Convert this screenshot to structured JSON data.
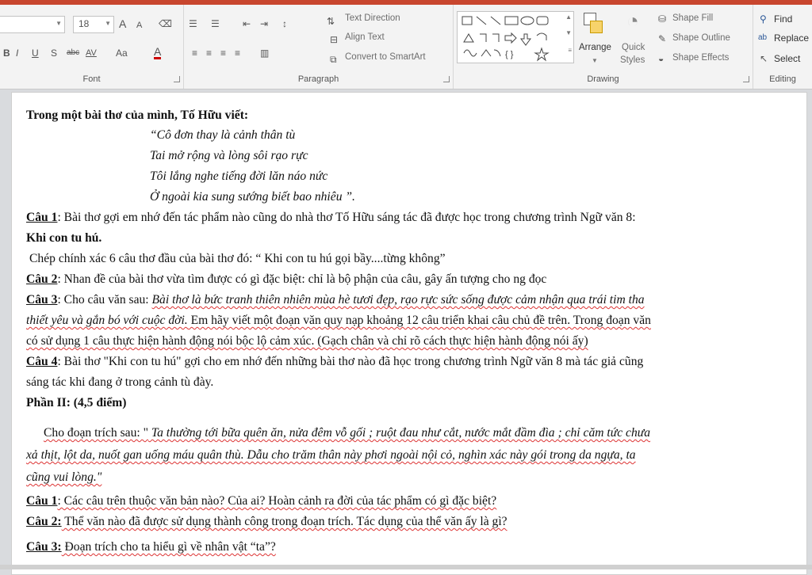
{
  "ribbon": {
    "font": {
      "label": "Font",
      "size_value": "18",
      "grow": "A",
      "shrink": "A",
      "bold": "B",
      "italic": "I",
      "underline": "U",
      "shadow": "S",
      "strike": "abc",
      "spacing": "AV",
      "case": "Aa",
      "color": "A"
    },
    "paragraph": {
      "label": "Paragraph",
      "text_direction": "Text Direction",
      "align_text": "Align Text",
      "convert_smartart": "Convert to SmartArt"
    },
    "drawing": {
      "label": "Drawing",
      "arrange": "Arrange",
      "quick_styles_1": "Quick",
      "quick_styles_2": "Styles",
      "shape_fill": "Shape Fill",
      "shape_outline": "Shape Outline",
      "shape_effects": "Shape Effects"
    },
    "editing": {
      "label": "Editing",
      "find": "Find",
      "replace": "Replace",
      "select": "Select"
    }
  },
  "slide": {
    "intro": "Trong một bài thơ của mình, Tố Hữu viết:",
    "verse": [
      "“Cô đơn thay là cảnh thân tù",
      "Tai mở rộng và lòng sôi rạo rực",
      "Tôi lắng nghe tiếng đời lăn náo nức",
      "Ở ngoài kia sung sướng biết bao nhiêu ”."
    ],
    "q1_label": "Câu 1",
    "q1_text": ": Bài thơ gợi em nhớ đến tác phẩm nào cũng do nhà thơ Tố Hữu sáng tác đã được học trong chương trình Ngữ văn 8:",
    "q1_answer": "Khi con tu hú.",
    "copy_line": "Chép chính xác 6 câu thơ đầu của bài thơ đó: “ Khi con tu hú gọi bầy....từng không”",
    "q2_label": "Câu 2",
    "q2_text": ": Nhan đề của bài thơ vừa tìm được có gì đặc biệt: chỉ là bộ phận của câu, gây ấn tượng cho ng đọc",
    "q3_label": "Câu 3",
    "q3_prefix": ": Cho câu văn sau: ",
    "q3_italic": "Bài thơ là bức tranh thiên nhiên mùa hè tươi đẹp, rạo rực sức sống được cảm nhận qua trái tim tha",
    "q3_line2_italic": "thiết yêu và gắn bó với cuộc đời.",
    "q3_line2_rest": " Em hãy viết một đoạn văn quy nạp khoảng 12 câu triển khai câu chủ đề trên. Trong đoạn văn",
    "q3_line3": "có sử dụng 1 câu thực hiện hành động nói bộc lộ cảm xúc. (Gạch chân và chỉ rõ cách thực hiện hành động nói ấy)",
    "q4_label": "Câu 4",
    "q4_text": ": Bài thơ \"Khi con tu hú\"  gợi cho em nhớ đến những bài thơ nào đã học trong chương trình Ngữ văn 8 mà tác giả cũng",
    "q4_line2": "sáng tác khi đang ở trong cảnh tù đày.",
    "part2": "Phần II: (4,5 điểm)",
    "excerpt_prefix": "Cho đoạn trích sau: \"",
    "excerpt_line1": " Ta thường tới bữa quên ăn, nửa đêm vỗ gối ; ruột đau như cắt, nước mắt đầm đìa ; chỉ căm tức chưa",
    "excerpt_line2": "xả thịt, lột da, nuốt gan uống máu quân thù. Dẫu cho trăm thân này phơi ngoài nội cỏ, nghìn xác này gói trong da ngựa, ta",
    "excerpt_line3": "cũng vui lòng.\"",
    "p2q1_label": "Câu 1",
    "p2q1_text": ": Các câu trên thuộc văn bản nào? Của ai? Hoàn cảnh ra đời của tác phẩm có gì đặc biệt?",
    "p2q2_label": "Câu 2:",
    "p2q2_text": " Thể văn nào đã được sử dụng thành công trong đoạn trích. Tác dụng của thể văn ấy là gì?",
    "p2q3_label": "Câu 3:",
    "p2q3_text": " Đoạn trích cho ta hiểu gì về nhân vật “ta”?"
  }
}
